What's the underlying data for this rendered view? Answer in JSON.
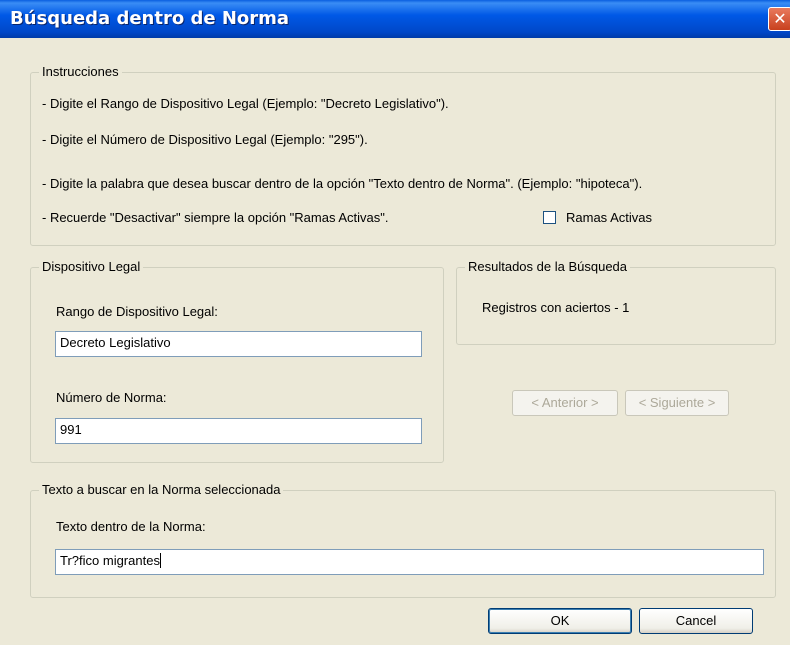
{
  "window": {
    "title": "Búsqueda dentro de Norma",
    "close_glyph": "✕"
  },
  "instructions": {
    "legend": "Instrucciones",
    "lines": [
      "- Digite el Rango de Dispositivo Legal (Ejemplo: \"Decreto Legislativo\").",
      "- Digite el Número de Dispositivo Legal (Ejemplo: \"295\").",
      "- Digite la palabra que desea buscar dentro de la opción \"Texto dentro de Norma\". (Ejemplo: \"hipoteca\").",
      "- Recuerde \"Desactivar\" siempre la opción \"Ramas Activas\"."
    ],
    "ramas_activas_label": "Ramas Activas",
    "ramas_activas_checked": false
  },
  "dispositivo": {
    "legend": "Dispositivo Legal",
    "rango_label": "Rango de Dispositivo Legal:",
    "rango_value": "Decreto Legislativo",
    "numero_label": "Número de Norma:",
    "numero_value": "991"
  },
  "resultados": {
    "legend": "Resultados de la Búsqueda",
    "registros_text": "Registros con aciertos - 1"
  },
  "navigation": {
    "anterior_label": "< Anterior >",
    "siguiente_label": "< Siguiente >"
  },
  "texto": {
    "legend": "Texto a buscar en la Norma seleccionada",
    "label": "Texto dentro de la Norma:",
    "value": "Tr?fico migrantes"
  },
  "footer": {
    "ok_label": "OK",
    "cancel_label": "Cancel"
  }
}
